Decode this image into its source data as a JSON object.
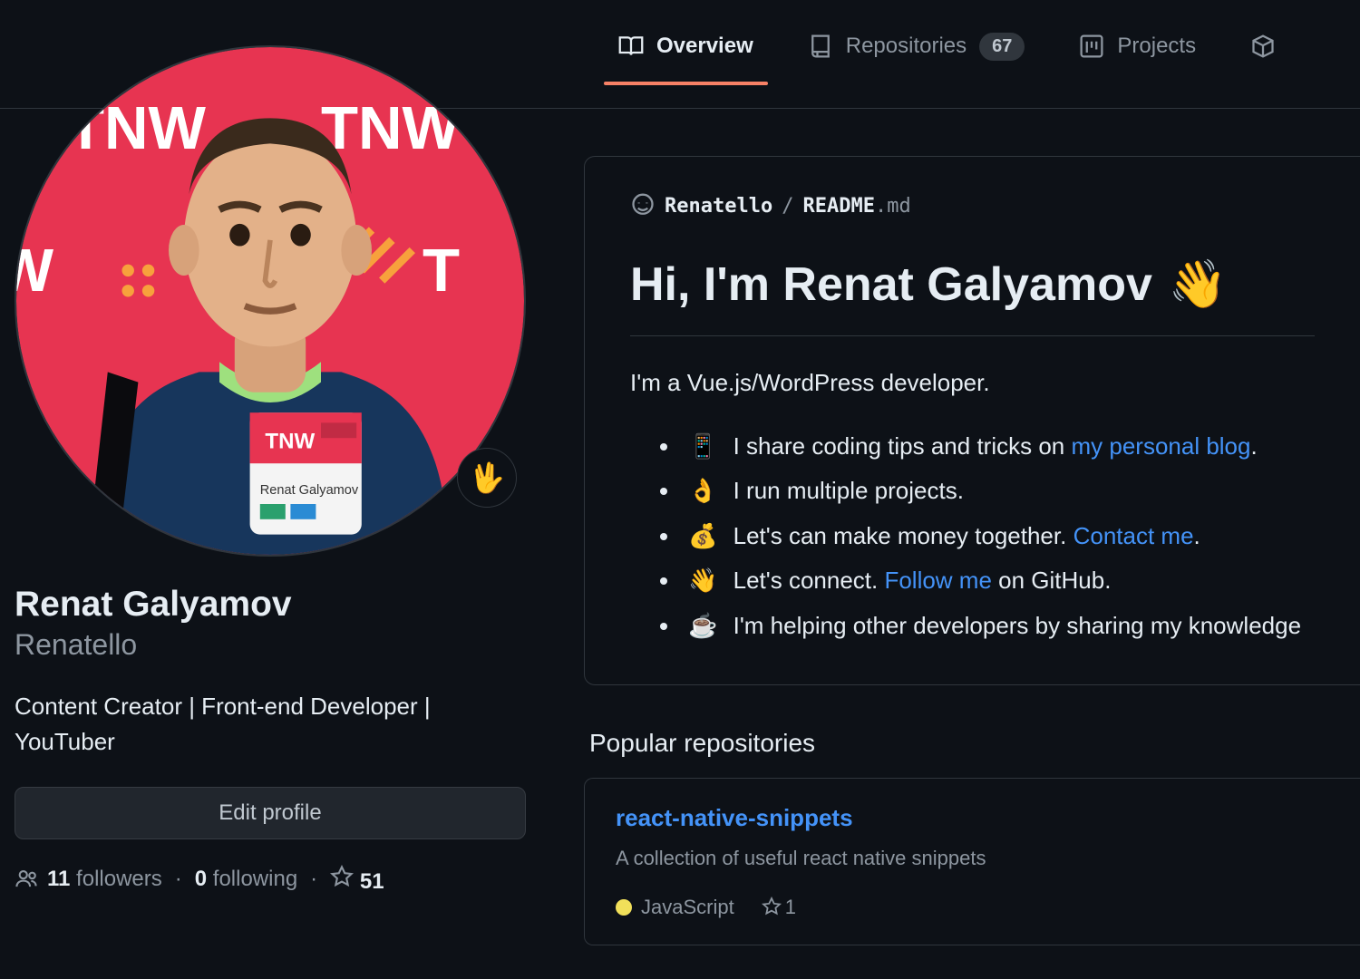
{
  "tabs": {
    "overview": "Overview",
    "repositories": "Repositories",
    "repositories_count": "67",
    "projects": "Projects"
  },
  "profile": {
    "status_emoji": "🖖",
    "display_name": "Renat Galyamov",
    "username": "Renatello",
    "bio": "Content Creator | Front-end Developer | YouTuber",
    "edit_button": "Edit profile",
    "followers_count": "11",
    "followers_label": "followers",
    "following_count": "0",
    "following_label": "following",
    "stars_count": "51"
  },
  "readme": {
    "path_user": "Renatello",
    "path_sep": "/",
    "path_file_strong": "README",
    "path_file_ext": ".md",
    "heading": "Hi, I'm Renat Galyamov",
    "heading_emoji": "👋",
    "intro": "I'm a Vue.js/WordPress developer.",
    "items": [
      {
        "emoji": "📱",
        "before": "I share coding tips and tricks on ",
        "link": "my personal blog",
        "after": "."
      },
      {
        "emoji": "👌",
        "before": "I run multiple projects.",
        "link": "",
        "after": ""
      },
      {
        "emoji": "💰",
        "before": "Let's can make money together. ",
        "link": "Contact me",
        "after": "."
      },
      {
        "emoji": "👋",
        "before": "Let's connect. ",
        "link": "Follow me",
        "after": " on GitHub."
      },
      {
        "emoji": "☕",
        "before": "I'm helping other developers by sharing my knowledge",
        "link": "",
        "after": ""
      }
    ]
  },
  "popular": {
    "heading": "Popular repositories",
    "repo": {
      "name": "react-native-snippets",
      "desc": "A collection of useful react native snippets",
      "language": "JavaScript",
      "stars": "1"
    }
  }
}
